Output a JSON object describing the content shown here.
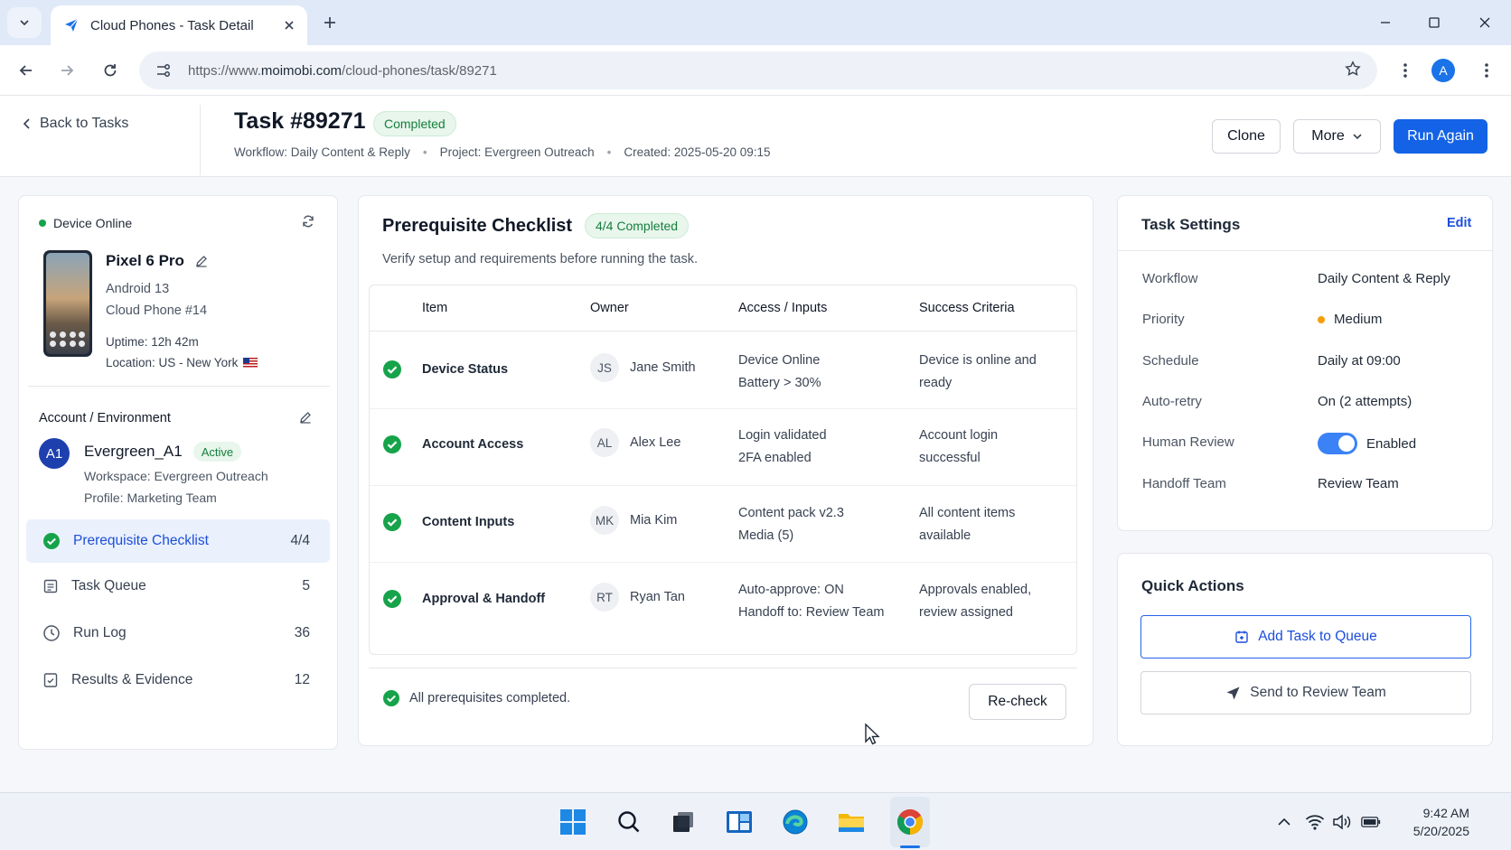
{
  "browser": {
    "tab_title": "Cloud Phones - Task Detail",
    "url_prefix": "https://www.",
    "url_domain": "moimobi.com",
    "url_path": "/cloud-phones/task/89271",
    "profile_initial": "A"
  },
  "header": {
    "back_label": "Back to Tasks",
    "task_title": "Task #89271",
    "status": "Completed",
    "workflow": "Workflow: Daily Content & Reply",
    "project": "Project: Evergreen Outreach",
    "created": "Created: 2025-05-20 09:15",
    "separator": "•",
    "clone_label": "Clone",
    "more_label": "More",
    "run_again_label": "Run Again"
  },
  "device": {
    "status": "Device Online",
    "name": "Pixel 6 Pro",
    "os": "Android 13",
    "phone_id": "Cloud Phone #14",
    "uptime": "Uptime: 12h 42m",
    "location": "Location: US - New York"
  },
  "account": {
    "section_title": "Account / Environment",
    "initials": "A1",
    "name": "Evergreen_A1",
    "status": "Active",
    "workspace": "Workspace: Evergreen Outreach",
    "profile": "Profile: Marketing Team"
  },
  "sidebar": {
    "items": [
      {
        "label": "Prerequisite Checklist",
        "count": "4/4"
      },
      {
        "label": "Task Queue",
        "count": "5"
      },
      {
        "label": "Run Log",
        "count": "36"
      },
      {
        "label": "Results & Evidence",
        "count": "12"
      }
    ]
  },
  "checklist": {
    "title": "Prerequisite Checklist",
    "badge": "4/4 Completed",
    "subtitle": "Verify setup and requirements before running the task.",
    "columns": [
      "Item",
      "Owner",
      "Access / Inputs",
      "Success Criteria"
    ],
    "rows": [
      {
        "item": "Device Status",
        "initials": "JS",
        "owner": "Jane Smith",
        "access1": "Device Online",
        "access2": "Battery > 30%",
        "criteria1": "Device is online and",
        "criteria2": "ready"
      },
      {
        "item": "Account Access",
        "initials": "AL",
        "owner": "Alex Lee",
        "access1": "Login validated",
        "access2": "2FA enabled",
        "criteria1": "Account login",
        "criteria2": "successful"
      },
      {
        "item": "Content Inputs",
        "initials": "MK",
        "owner": "Mia Kim",
        "access1": "Content pack v2.3",
        "access2": "Media (5)",
        "criteria1": "All content items",
        "criteria2": "available"
      },
      {
        "item": "Approval & Handoff",
        "initials": "RT",
        "owner": "Ryan Tan",
        "access1": "Auto-approve: ON",
        "access2": "Handoff to: Review Team",
        "criteria1": "Approvals enabled,",
        "criteria2": "review assigned"
      }
    ],
    "footer_text": "All prerequisites completed.",
    "recheck_label": "Re-check"
  },
  "settings": {
    "title": "Task Settings",
    "edit_label": "Edit",
    "rows": [
      {
        "label": "Workflow",
        "value": "Daily Content & Reply"
      },
      {
        "label": "Priority",
        "value": "Medium"
      },
      {
        "label": "Schedule",
        "value": "Daily at 09:00"
      },
      {
        "label": "Auto-retry",
        "value": "On (2 attempts)"
      },
      {
        "label": "Human Review",
        "value": "Enabled"
      },
      {
        "label": "Handoff Team",
        "value": "Review Team"
      }
    ],
    "human_review_enabled": true
  },
  "quick_actions": {
    "title": "Quick Actions",
    "add_label": "Add Task to Queue",
    "send_label": "Send to Review Team"
  },
  "taskbar": {
    "time": "9:42 AM",
    "date": "5/20/2025"
  },
  "colors": {
    "primary": "#1463e6",
    "success": "#16a34a",
    "warning": "#f59e0b"
  }
}
